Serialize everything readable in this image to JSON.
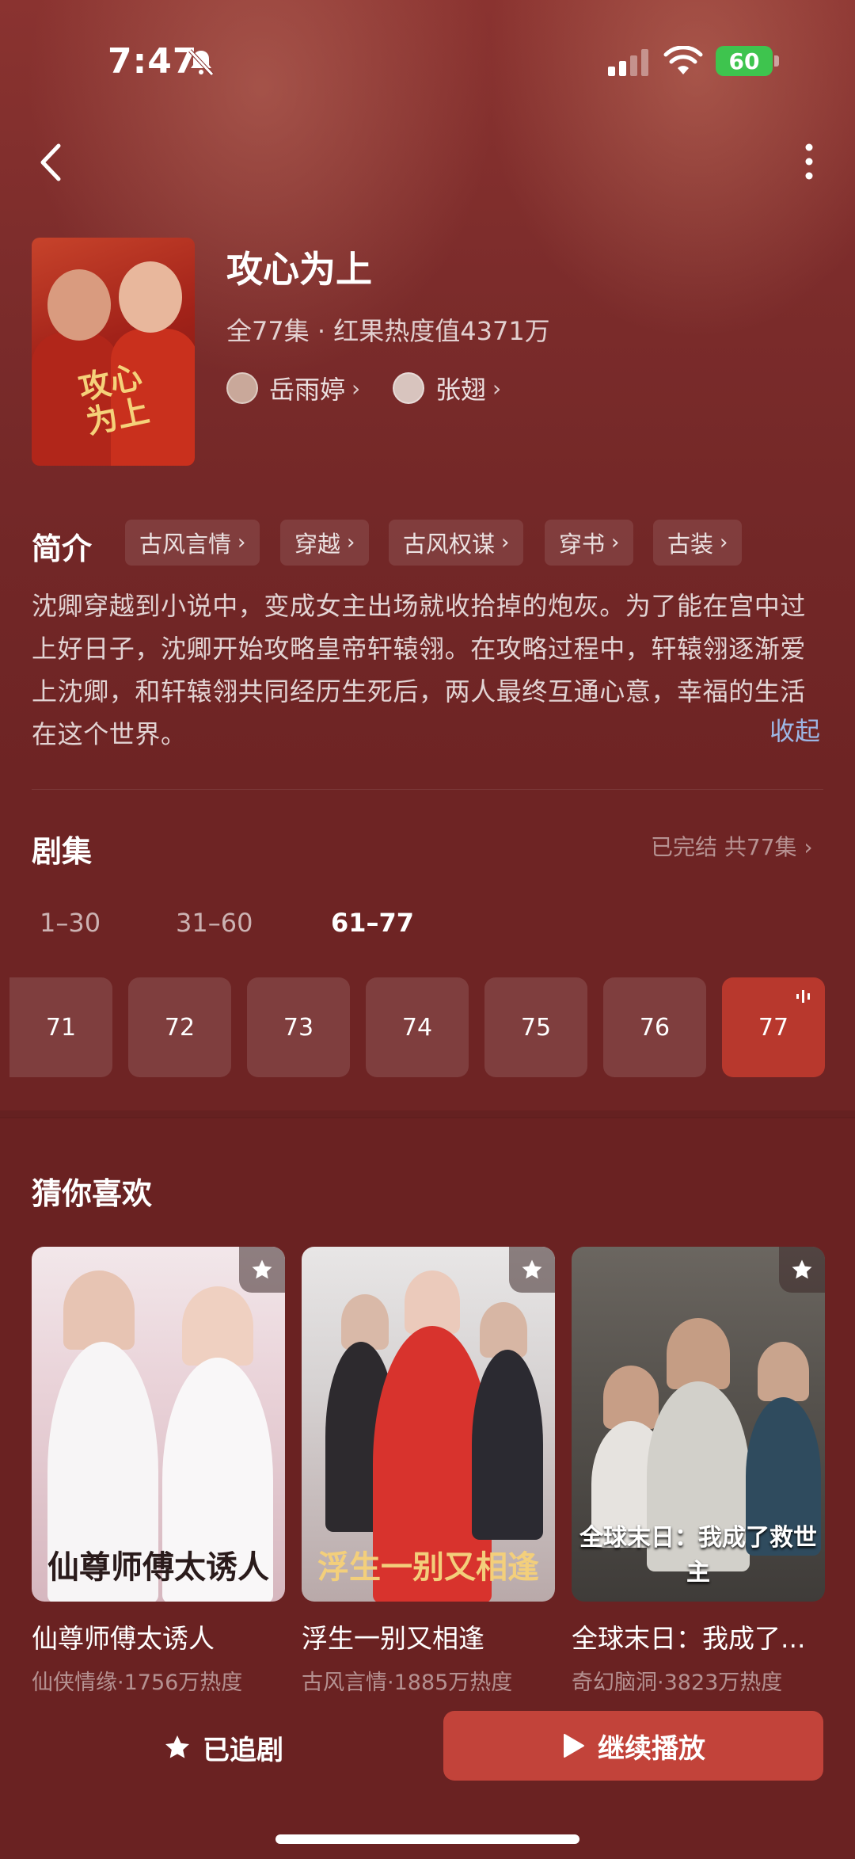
{
  "status_bar": {
    "time": "7:47",
    "battery": "60"
  },
  "header": {
    "back_icon": "chevron-left-icon",
    "more_icon": "more-vertical-icon"
  },
  "show": {
    "title": "攻心为上",
    "meta": "全77集 · 红果热度值4371万",
    "poster_text": "攻心为上",
    "actors": [
      {
        "name": "岳雨婷"
      },
      {
        "name": "张翅"
      }
    ]
  },
  "intro": {
    "label": "简介",
    "tags": [
      "古风言情",
      "穿越",
      "古风权谋",
      "穿书",
      "古装"
    ],
    "synopsis": "沈卿穿越到小说中，变成女主出场就收拾掉的炮灰。为了能在宫中过上好日子，沈卿开始攻略皇帝轩辕翎。在攻略过程中，轩辕翎逐渐爱上沈卿，和轩辕翎共同经历生死后，两人最终互通心意，幸福的生活在这个世界。",
    "collapse_label": "收起"
  },
  "episodes": {
    "label": "剧集",
    "status": "已完结 共77集 ›",
    "ranges": [
      "1–30",
      "31–60",
      "61–77"
    ],
    "active_range": "61–77",
    "items": [
      "71",
      "72",
      "73",
      "74",
      "75",
      "76",
      "77"
    ],
    "current": "77"
  },
  "recommend": {
    "label": "猜你喜欢",
    "items": [
      {
        "title": "仙尊师傅太诱人",
        "sub": "仙侠情缘·1756万热度",
        "poster_text": "仙尊师傅太诱人"
      },
      {
        "title": "浮生一别又相逢",
        "sub": "古风言情·1885万热度",
        "poster_text": "浮生一别又相逢"
      },
      {
        "title": "全球末日：我成了...",
        "sub": "奇幻脑洞·3823万热度",
        "poster_text": "全球末日：我成了救世主"
      }
    ]
  },
  "actions": {
    "follow_label": "已追剧",
    "play_label": "继续播放"
  },
  "colors": {
    "accent": "#c2433a",
    "link": "#9db7e6",
    "background": "#6e2424"
  }
}
